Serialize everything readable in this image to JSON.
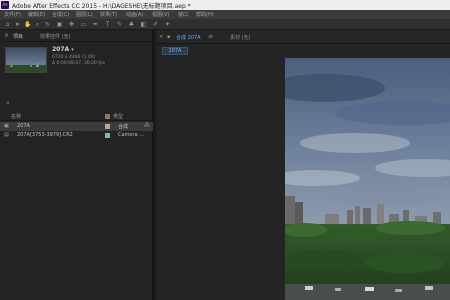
{
  "window": {
    "title": "Adobe After Effects CC 2015 - H:\\DAGESHE\\无标题项目.aep *",
    "app_icon_text": "Ae"
  },
  "menu": {
    "items": [
      "文件(F)",
      "编辑(E)",
      "合成(C)",
      "图层(L)",
      "效果(T)",
      "动画(A)",
      "视图(V)",
      "窗口",
      "帮助(H)"
    ]
  },
  "project_panel": {
    "tabs": [
      "项目",
      "效果控件 (无)"
    ],
    "active_tab": 0,
    "selected_item": {
      "name": "207A",
      "line1": "6720 x 4480 (1.00)",
      "line2": "Δ 0;00;08;07, 30.00 fps"
    },
    "columns": [
      "名称",
      "类型"
    ],
    "rows": [
      {
        "name": "207A",
        "type": "合成",
        "selected": true,
        "swatch": "#b9a98a",
        "icon": "composition-icon"
      },
      {
        "name": "207A[3753-3979].CR2",
        "type": "Camera ...",
        "selected": false,
        "swatch": "#7fb8b8",
        "icon": "footage-icon"
      }
    ]
  },
  "composition_panel": {
    "tabs": [
      "合成 207A",
      "素材 (无)"
    ],
    "chip": "207A"
  },
  "colors": {
    "accent_blue": "#6aa4ff",
    "panel_bg": "#232323",
    "menubar": "#3a3a3a"
  }
}
